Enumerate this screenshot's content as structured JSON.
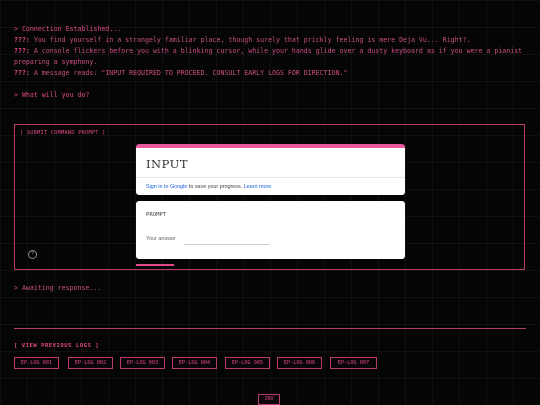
{
  "terminal": {
    "line1": "> Connection Established...",
    "line2_label": "???:",
    "line2_text": " You find yourself in a strangely familiar place, though surely that prickly feeling is mere Deja Vu... Right?.",
    "line3_label": "???:",
    "line3_text": " A console flickers before you with a blinking cursor, while your hands glide over a dusty keyboard as if you were a pianist preparing a symphony.",
    "line4_label": "???:",
    "line4_text": " A message reads: \"INPUT REQUIRED TO PROCEED. CONSULT EARLY LOGS FOR DIRECTION.\"",
    "prompt": "> What will you do?"
  },
  "panel": {
    "title": "[ SUBMIT COMMAND PROMPT ]",
    "help_icon": "?"
  },
  "form": {
    "title": "INPUT",
    "signin_link": "Sign in to Google",
    "signin_mid": " to save your progress. ",
    "learn_more": "Learn more",
    "question": "PROMPT",
    "answer_placeholder": "Your answer"
  },
  "status": "> Awaiting response...",
  "logs": {
    "title": "[ VIEW PREVIOUS LOGS ]",
    "items": [
      "EP-LOG 001",
      "EP-LOG 002",
      "EP-LOG 003",
      "EP-LOG 004",
      "EP-LOG 005",
      "EP-LOG 006",
      "EP-LOG 007"
    ]
  },
  "inventory_button": "INV",
  "colors": {
    "accent": "#e24a8a",
    "form_top": "#e85a9c",
    "link": "#1a5fd8"
  }
}
